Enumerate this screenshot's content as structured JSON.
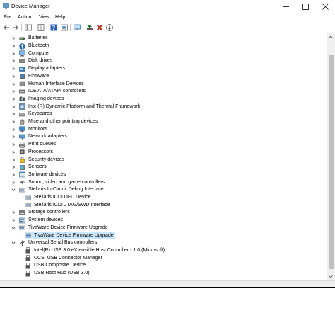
{
  "window": {
    "title": "Device Manager",
    "minimize_glyph": "—",
    "maximize_glyph": "☐",
    "close_glyph": "✕"
  },
  "menu": [
    "File",
    "Action",
    "View",
    "Help"
  ],
  "toolbar": {
    "buttons": [
      "back-icon",
      "forward-icon",
      "show-hide-icon",
      "properties-icon",
      "help-icon",
      "view-icon",
      "scan-hardware-icon",
      "update-driver-icon",
      "uninstall-icon",
      "install-icon"
    ]
  },
  "tree": [
    {
      "label": "Batteries",
      "level": 1,
      "expanded": false,
      "icon": "battery-icon"
    },
    {
      "label": "Bluetooth",
      "level": 1,
      "expanded": false,
      "icon": "bluetooth-icon"
    },
    {
      "label": "Computer",
      "level": 1,
      "expanded": false,
      "icon": "computer-icon"
    },
    {
      "label": "Disk drives",
      "level": 1,
      "expanded": false,
      "icon": "disk-drive-icon"
    },
    {
      "label": "Display adapters",
      "level": 1,
      "expanded": false,
      "icon": "display-adapter-icon"
    },
    {
      "label": "Firmware",
      "level": 1,
      "expanded": false,
      "icon": "firmware-icon"
    },
    {
      "label": "Human Interface Devices",
      "level": 1,
      "expanded": false,
      "icon": "hid-icon"
    },
    {
      "label": "IDE ATA/ATAPI controllers",
      "level": 1,
      "expanded": false,
      "icon": "ide-controller-icon"
    },
    {
      "label": "Imaging devices",
      "level": 1,
      "expanded": false,
      "icon": "camera-icon"
    },
    {
      "label": "Intel(R) Dynamic Platform and Thermal Framework",
      "level": 1,
      "expanded": false,
      "icon": "thermal-framework-icon"
    },
    {
      "label": "Keyboards",
      "level": 1,
      "expanded": false,
      "icon": "keyboard-icon"
    },
    {
      "label": "Mice and other pointing devices",
      "level": 1,
      "expanded": false,
      "icon": "mouse-icon"
    },
    {
      "label": "Monitors",
      "level": 1,
      "expanded": false,
      "icon": "monitor-icon"
    },
    {
      "label": "Network adapters",
      "level": 1,
      "expanded": false,
      "icon": "network-adapter-icon"
    },
    {
      "label": "Print queues",
      "level": 1,
      "expanded": false,
      "icon": "printer-icon"
    },
    {
      "label": "Processors",
      "level": 1,
      "expanded": false,
      "icon": "processor-icon"
    },
    {
      "label": "Security devices",
      "level": 1,
      "expanded": false,
      "icon": "security-device-icon"
    },
    {
      "label": "Sensors",
      "level": 1,
      "expanded": false,
      "icon": "sensor-icon"
    },
    {
      "label": "Software devices",
      "level": 1,
      "expanded": false,
      "icon": "software-device-icon"
    },
    {
      "label": "Sound, video and game controllers",
      "level": 1,
      "expanded": false,
      "icon": "sound-icon"
    },
    {
      "label": "Stellaris In-Circuit Debug Interface",
      "level": 1,
      "expanded": true,
      "icon": "usb-device-icon"
    },
    {
      "label": "Stellaris ICDI DFU Device",
      "level": 2,
      "icon": "usb-device-icon"
    },
    {
      "label": "Stellaris ICDI JTAG/SWD Interface",
      "level": 2,
      "icon": "usb-device-icon"
    },
    {
      "label": "Storage controllers",
      "level": 1,
      "expanded": false,
      "icon": "storage-controller-icon"
    },
    {
      "label": "System devices",
      "level": 1,
      "expanded": false,
      "icon": "system-device-icon"
    },
    {
      "label": "TivaWare Device Firmware Upgrade",
      "level": 1,
      "expanded": true,
      "icon": "usb-device-icon"
    },
    {
      "label": "TivaWare Device Firmware Upgrade",
      "level": 2,
      "icon": "usb-device-icon",
      "selected": true
    },
    {
      "label": "Universal Serial Bus controllers",
      "level": 1,
      "expanded": true,
      "icon": "usb-controller-icon"
    },
    {
      "label": "Intel(R) USB 3.0 eXtensible Host Controller - 1.0 (Microsoft)",
      "level": 2,
      "icon": "usb-connector-icon"
    },
    {
      "label": "UCSI USB Connector Manager",
      "level": 2,
      "icon": "usb-connector-icon"
    },
    {
      "label": "USB Composite Device",
      "level": 2,
      "icon": "usb-connector-icon"
    },
    {
      "label": "USB Root Hub (USB 3.0)",
      "level": 2,
      "icon": "usb-connector-icon"
    }
  ],
  "colors": {
    "selection": "#cce8ff",
    "accent_blue": "#0078d7",
    "uninstall_red": "#c42b1c",
    "install_green": "#107c10"
  }
}
